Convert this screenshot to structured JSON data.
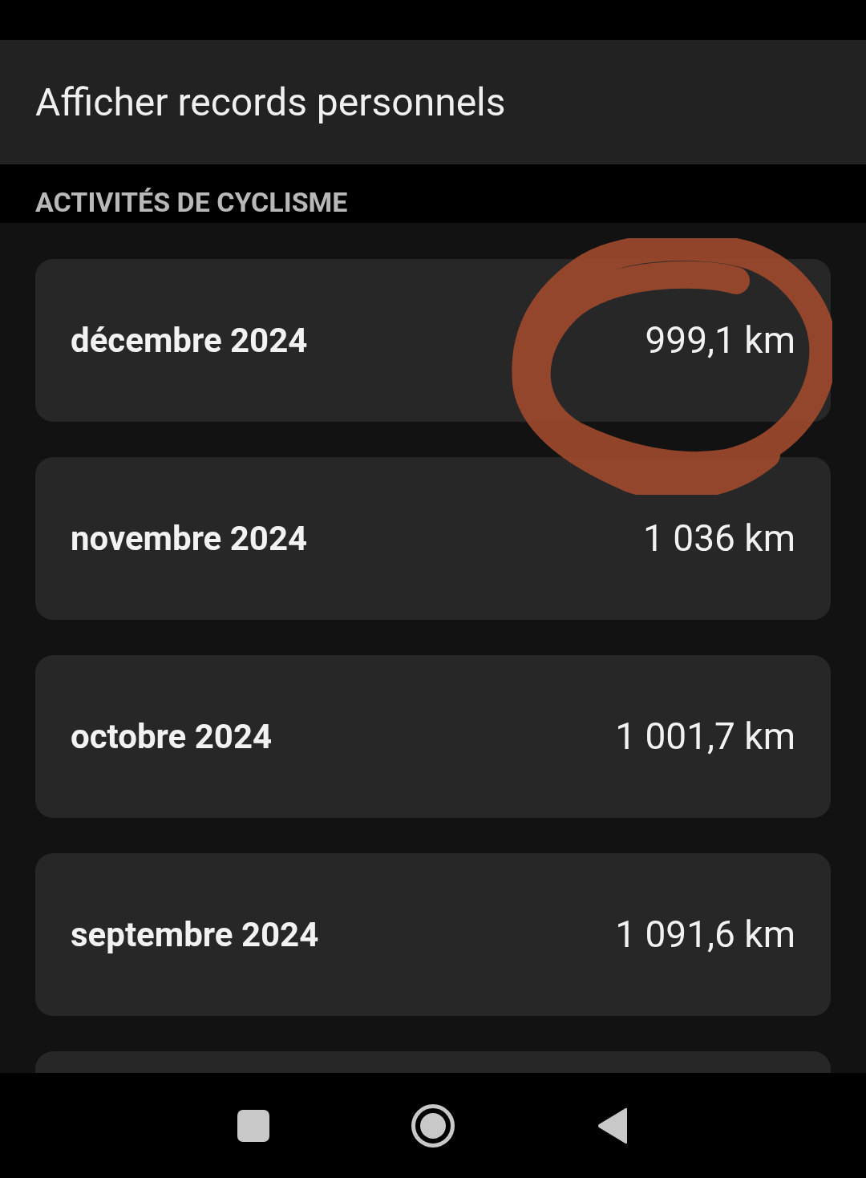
{
  "header": {
    "title": "Afficher records personnels"
  },
  "section": {
    "title": "ACTIVITÉS DE CYCLISME"
  },
  "rows": [
    {
      "label": "décembre 2024",
      "value": "999,1 km"
    },
    {
      "label": "novembre 2024",
      "value": "1 036 km"
    },
    {
      "label": "octobre 2024",
      "value": "1 001,7 km"
    },
    {
      "label": "septembre 2024",
      "value": "1 091,6 km"
    }
  ]
}
